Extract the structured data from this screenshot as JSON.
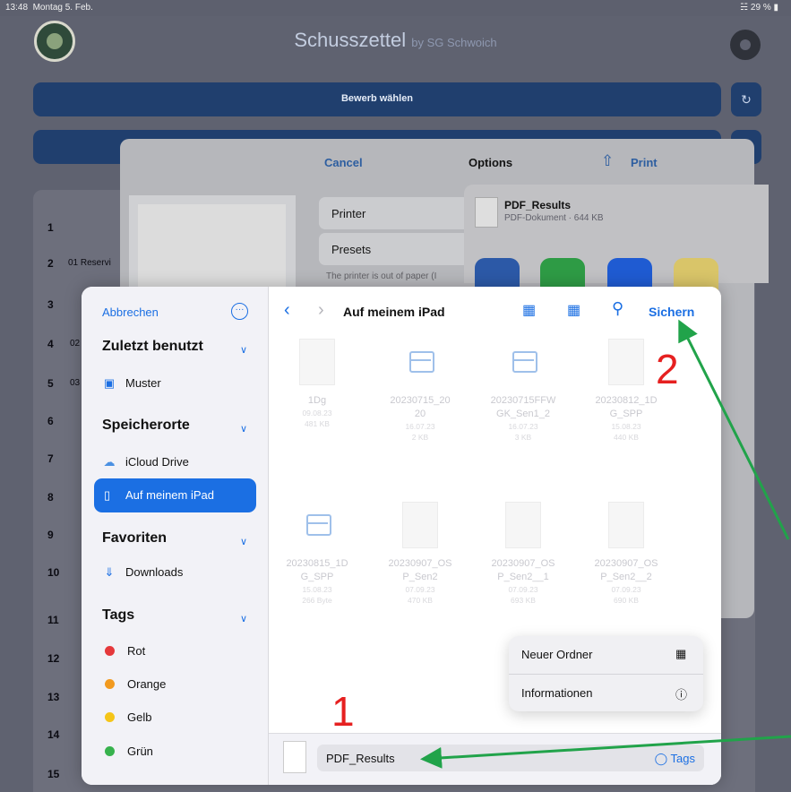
{
  "status": {
    "time": "13:48",
    "date": "Montag 5. Feb.",
    "battery": "29 %"
  },
  "app": {
    "title": "Schusszettel",
    "byline": "by SG Schwoich",
    "bar1_label": "Bewerb wählen"
  },
  "rows": [
    {
      "num": "1",
      "text": ""
    },
    {
      "num": "2",
      "text": "01 Reservi"
    },
    {
      "num": "3",
      "text": ""
    },
    {
      "num": "4",
      "text": "02"
    },
    {
      "num": "5",
      "text": "03"
    },
    {
      "num": "6",
      "text": ""
    },
    {
      "num": "7",
      "text": ""
    },
    {
      "num": "8",
      "text": ""
    },
    {
      "num": "9",
      "text": ""
    },
    {
      "num": "10",
      "text": ""
    },
    {
      "num": "11",
      "text": ""
    },
    {
      "num": "12",
      "text": ""
    },
    {
      "num": "13",
      "text": ""
    },
    {
      "num": "14",
      "text": ""
    },
    {
      "num": "15",
      "text": ""
    }
  ],
  "print": {
    "cancel": "Cancel",
    "options": "Options",
    "print": "Print",
    "printer_label": "Printer",
    "presets_label": "Presets",
    "warning": "The printer is out of paper (I"
  },
  "share": {
    "doc_name": "PDF_Results",
    "doc_meta": "PDF-Dokument · 644 KB"
  },
  "picker": {
    "cancel": "Abbrechen",
    "sections": {
      "recent": "Zuletzt benutzt",
      "locations": "Speicherorte",
      "favorites": "Favoriten",
      "tags": "Tags"
    },
    "recent_items": [
      "Muster"
    ],
    "locations": [
      "iCloud Drive",
      "Auf meinem iPad"
    ],
    "favorites": [
      "Downloads"
    ],
    "tags": [
      {
        "label": "Rot",
        "color": "#e5383b"
      },
      {
        "label": "Orange",
        "color": "#f29a1f"
      },
      {
        "label": "Gelb",
        "color": "#f5c518"
      },
      {
        "label": "Grün",
        "color": "#37b24d"
      }
    ],
    "location_title": "Auf meinem iPad",
    "save": "Sichern",
    "files": [
      {
        "name1": "1Dg",
        "name2": "",
        "date": "09.08.23",
        "size": "481 KB",
        "kind": "doc"
      },
      {
        "name1": "20230715_20",
        "name2": "20",
        "date": "16.07.23",
        "size": "2 KB",
        "kind": "sheet"
      },
      {
        "name1": "20230715FFW",
        "name2": "GK_Sen1_2",
        "date": "16.07.23",
        "size": "3 KB",
        "kind": "sheet"
      },
      {
        "name1": "20230812_1D",
        "name2": "G_SPP",
        "date": "15.08.23",
        "size": "440 KB",
        "kind": "doc"
      },
      {
        "name1": "20230815_1D",
        "name2": "G_SPP",
        "date": "15.08.23",
        "size": "266 Byte",
        "kind": "sheet"
      },
      {
        "name1": "20230907_OS",
        "name2": "P_Sen2",
        "date": "07.09.23",
        "size": "470 KB",
        "kind": "doc"
      },
      {
        "name1": "20230907_OS",
        "name2": "P_Sen2__1",
        "date": "07.09.23",
        "size": "693 KB",
        "kind": "doc"
      },
      {
        "name1": "20230907_OS",
        "name2": "P_Sen2__2",
        "date": "07.09.23",
        "size": "690 KB",
        "kind": "doc"
      }
    ],
    "filename": "PDF_Results",
    "tags_button": "Tags",
    "menu": {
      "new_folder": "Neuer Ordner",
      "info": "Informationen"
    }
  },
  "annotations": {
    "step1": "1",
    "step2": "2",
    "arrow_color": "#21a34a"
  }
}
